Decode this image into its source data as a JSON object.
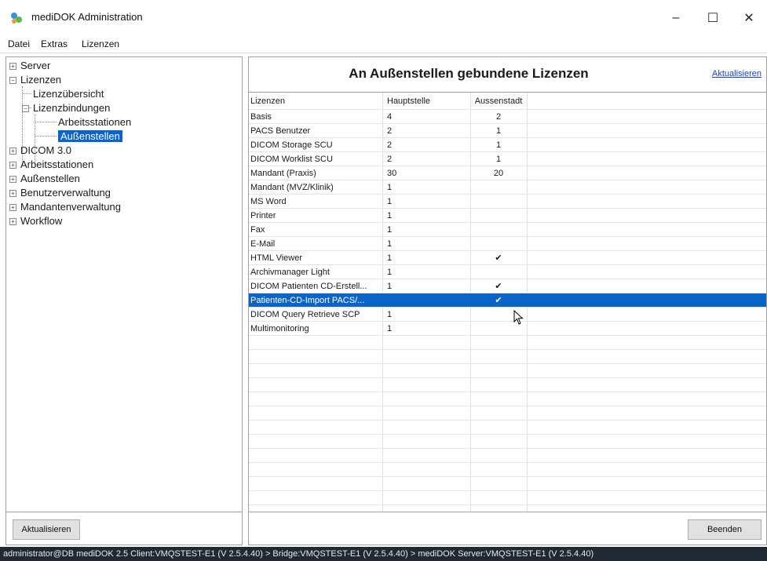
{
  "window": {
    "title": "mediDOK Administration",
    "minimize": "–",
    "maximize": "☐",
    "close": "✕"
  },
  "menu": [
    "Datei",
    "Extras",
    "Lizenzen"
  ],
  "tree": {
    "server": "Server",
    "lizenzen": "Lizenzen",
    "lizenzuebersicht": "Lizenzübersicht",
    "lizenzbindungen": "Lizenzbindungen",
    "arbeitsstationen_sub": "Arbeitsstationen",
    "aussenstellen_sub": "Außenstellen",
    "dicom": "DICOM 3.0",
    "arbeitsstationen": "Arbeitsstationen",
    "aussenstellen": "Außenstellen",
    "benutzerverwaltung": "Benutzerverwaltung",
    "mandantenverwaltung": "Mandantenverwaltung",
    "workflow": "Workflow"
  },
  "header": {
    "title": "An Außenstellen gebundene Lizenzen",
    "refresh_link": "Aktualisieren"
  },
  "table": {
    "columns": [
      "Lizenzen",
      "Hauptstelle",
      "Aussenstadt"
    ],
    "rows": [
      [
        "Basis",
        "4",
        "2"
      ],
      [
        "PACS Benutzer",
        "2",
        "1"
      ],
      [
        "DICOM Storage SCU",
        "2",
        "1"
      ],
      [
        "DICOM Worklist SCU",
        "2",
        "1"
      ],
      [
        "Mandant (Praxis)",
        "30",
        "20"
      ],
      [
        "Mandant (MVZ/Klinik)",
        "1",
        ""
      ],
      [
        "MS Word",
        "1",
        ""
      ],
      [
        "Printer",
        "1",
        ""
      ],
      [
        "Fax",
        "1",
        ""
      ],
      [
        "E-Mail",
        "1",
        ""
      ],
      [
        "HTML Viewer",
        "1",
        "✔"
      ],
      [
        "Archivmanager Light",
        "1",
        ""
      ],
      [
        "DICOM Patienten CD-Erstell...",
        "1",
        "✔"
      ],
      [
        "Patienten-CD-Import PACS/...",
        "",
        "✔"
      ],
      [
        "DICOM Query Retrieve SCP",
        "1",
        ""
      ],
      [
        "Multimonitoring",
        "1",
        ""
      ]
    ],
    "selected_row": 13
  },
  "buttons": {
    "left": "Aktualisieren",
    "right": "Beenden"
  },
  "status": "administrator@DB mediDOK 2.5   Client:VMQSTEST-E1 (V 2.5.4.40) > Bridge:VMQSTEST-E1 (V 2.5.4.40) > mediDOK Server:VMQSTEST-E1 (V 2.5.4.40)",
  "icons": {
    "app": "app-icon",
    "expand": "expand-icon",
    "collapse": "collapse-icon",
    "check": "check-icon",
    "cursor": "mouse-cursor-icon"
  },
  "colors": {
    "selection": "#0a64c8",
    "link": "#1a44c8",
    "statusbar": "#1f2833"
  }
}
